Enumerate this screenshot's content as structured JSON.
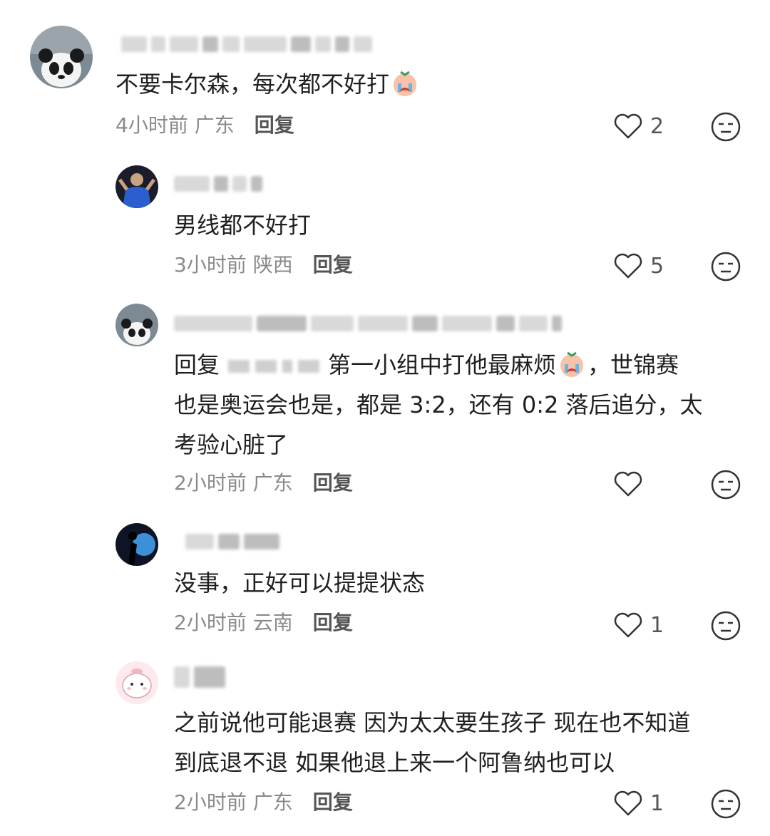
{
  "comments": [
    {
      "text": "不要卡尔森，每次都不好打",
      "time": "4小时前",
      "location": "广东",
      "reply": "回复",
      "likes": "2"
    },
    {
      "text": "男线都不好打",
      "time": "3小时前",
      "location": "陕西",
      "reply": "回复",
      "likes": "5"
    },
    {
      "prefix": "回复",
      "text_line1": "第一小组中打他最麻烦",
      "text_line1b": "，世锦赛",
      "text_line2": "也是奥运会也是，都是 3:2，还有 0:2 落后追分，太",
      "text_line3": "考验心脏了",
      "time": "2小时前",
      "location": "广东",
      "reply": "回复",
      "likes": ""
    },
    {
      "text": "没事，正好可以提提状态",
      "time": "2小时前",
      "location": "云南",
      "reply": "回复",
      "likes": "1"
    },
    {
      "text_line1": "之前说他可能退赛 因为太太要生孩子 现在也不知道",
      "text_line2": "到底退不退 如果他退上来一个阿鲁纳也可以",
      "time": "2小时前",
      "location": "广东",
      "reply": "回复",
      "likes": "1"
    }
  ]
}
